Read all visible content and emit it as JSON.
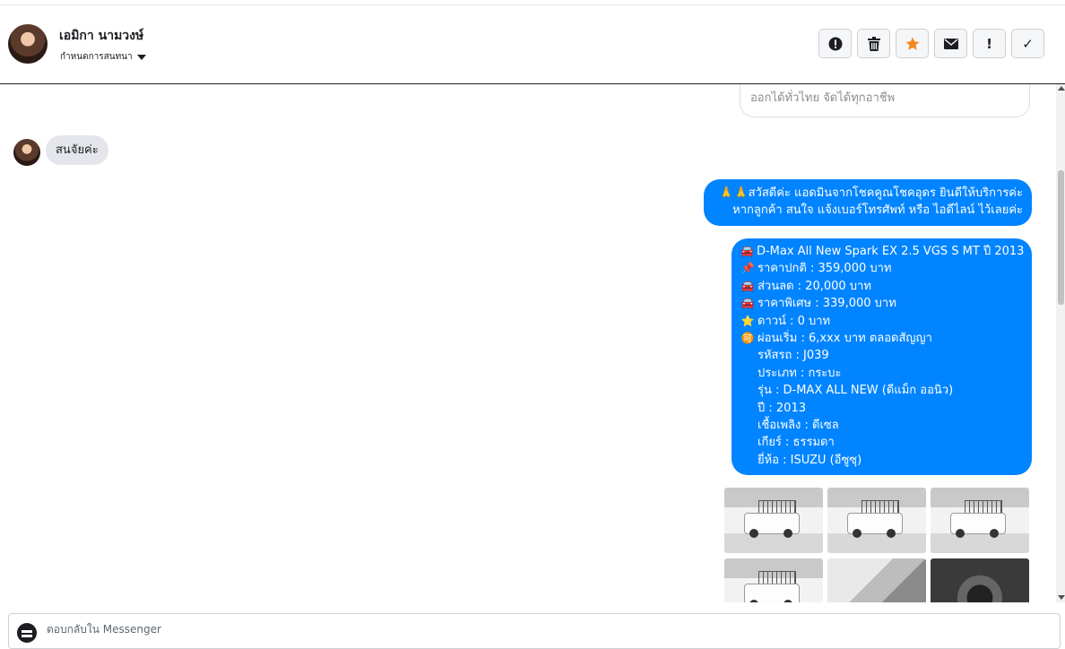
{
  "header": {
    "contact_name": "เอมิกา นามวงษ์",
    "assign_label": "กำหนดการสนทนา",
    "actions": [
      {
        "name": "spam-button",
        "icon": "alert-circle-icon"
      },
      {
        "name": "delete-button",
        "icon": "trash-icon"
      },
      {
        "name": "star-button",
        "icon": "star-icon",
        "color": "#f5871f"
      },
      {
        "name": "mark-unread-button",
        "icon": "envelope-icon"
      },
      {
        "name": "follow-up-button",
        "icon": "exclamation-icon",
        "glyph": "!"
      },
      {
        "name": "done-button",
        "icon": "check-icon",
        "glyph": "✓"
      }
    ]
  },
  "chat": {
    "card_text": "ออกได้ทั่วไทย จัดได้ทุกอาชีพ",
    "incoming_message": "สนจัยค่ะ",
    "greeting": {
      "line1": "🙏🙏สวัสดีค่ะ แอดมินจากโชคคูณโชคอุดร ยินดีให้บริการค่ะ",
      "line2": "หากลูกค้า สนใจ แจ้งเบอร์โทรศัพท์ หรือ ไอดีไลน์  ไว้เลยค่ะ"
    },
    "listing": [
      {
        "emoji": "🚘",
        "text": "D-Max All New Spark EX 2.5 VGS S MT ปี 2013"
      },
      {
        "emoji": "📌",
        "text": "ราคาปกติ : 359,000 บาท"
      },
      {
        "emoji": "🚘",
        "text": "ส่วนลด : 20,000 บาท"
      },
      {
        "emoji": "🚘",
        "text": "ราคาพิเศษ : 339,000 บาท"
      },
      {
        "emoji": "⭐",
        "text": "ดาวน์ : 0 บาท"
      },
      {
        "emoji": "🉑",
        "text": "ผ่อนเริ่ม : 6,xxx บาท ตลอดสัญญา"
      },
      {
        "emoji": "",
        "text": "รหัสรถ : J039"
      },
      {
        "emoji": "",
        "text": "ประเภท : กระบะ"
      },
      {
        "emoji": "",
        "text": "รุ่น : D-MAX ALL NEW (ดีแม็ก ออนิว)"
      },
      {
        "emoji": "",
        "text": "ปี : 2013"
      },
      {
        "emoji": "",
        "text": "เชื้อเพลิง : ดีเซล"
      },
      {
        "emoji": "",
        "text": "เกียร์ : ธรรมดา"
      },
      {
        "emoji": "",
        "text": "ยี่ห้อ : ISUZU (อีซูซุ)"
      }
    ],
    "photos": [
      "truck-front",
      "truck-rear",
      "truck-side",
      "truck-side",
      "interior-seat",
      "interior-dashboard"
    ]
  },
  "composer": {
    "placeholder": "ตอบกลับใน Messenger"
  }
}
